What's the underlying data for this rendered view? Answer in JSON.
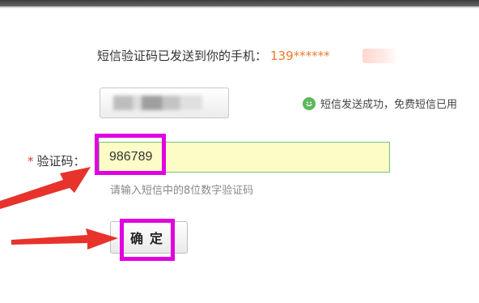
{
  "sms_notice": {
    "text": "短信验证码已发送到你的手机：",
    "phone": "139******"
  },
  "resend_button": {
    "label_obscured": true
  },
  "status": {
    "icon": "smile-icon",
    "text": "短信发送成功，免费短信已用"
  },
  "code_field": {
    "required_mark": "*",
    "label": "验证码：",
    "value": "986789",
    "hint": "请输入短信中的8位数字验证码"
  },
  "confirm_button": {
    "label": "确定"
  },
  "annotations": {
    "highlight_color": "#e000e0",
    "arrow_color": "#e8322c"
  }
}
